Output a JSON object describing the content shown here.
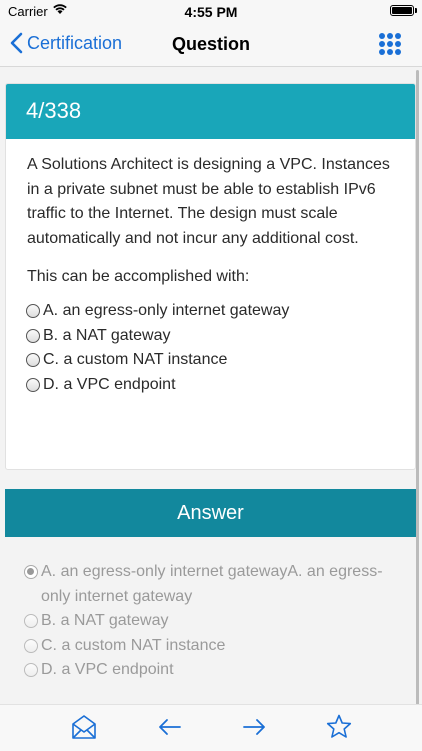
{
  "status": {
    "carrier": "Carrier",
    "time": "4:55 PM"
  },
  "nav": {
    "back_label": "Certification",
    "title": "Question"
  },
  "question": {
    "counter": "4/338",
    "text": "A Solutions Architect is designing a VPC. Instances in a private subnet must be able to establish IPv6 traffic to the Internet. The design must scale automatically and not incur any additional cost.",
    "prompt": "This can be accomplished with:",
    "options": [
      "A. an egress-only internet gateway",
      "B. a NAT gateway",
      "C. a custom NAT instance",
      "D. a VPC endpoint"
    ]
  },
  "answer": {
    "header": "Answer",
    "options": [
      "A. an egress-only internet gatewayA. an egress-only internet gateway",
      "B. a NAT gateway",
      "C. a custom NAT instance",
      "D. a VPC endpoint"
    ],
    "selected_index": 0
  },
  "toolbar": {
    "icons": [
      "envelope-icon",
      "arrow-left-icon",
      "arrow-right-icon",
      "star-icon"
    ]
  },
  "colors": {
    "accent": "#1a6fd6",
    "question_header": "#19a6b9",
    "answer_header": "#12889d"
  }
}
